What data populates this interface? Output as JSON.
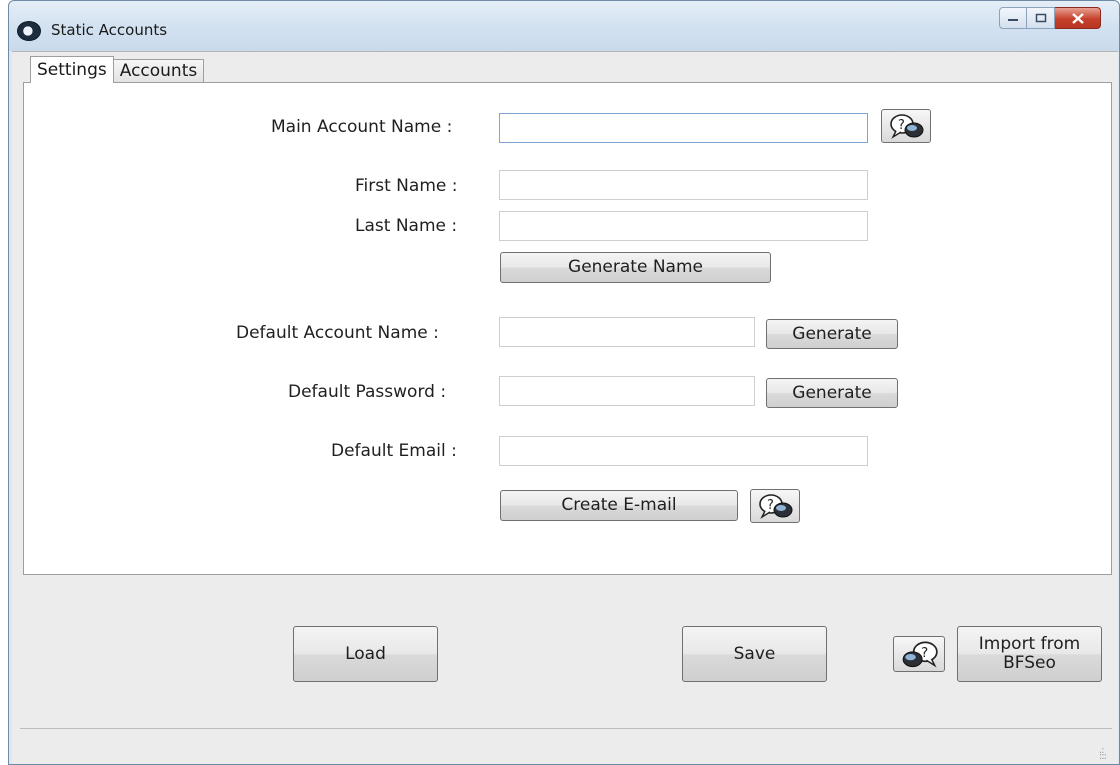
{
  "window": {
    "title": "Static Accounts"
  },
  "tabs": [
    {
      "label": "Settings"
    },
    {
      "label": "Accounts"
    }
  ],
  "form": {
    "main_account_name": {
      "label": "Main Account Name :",
      "value": ""
    },
    "first_name": {
      "label": "First Name :",
      "value": ""
    },
    "last_name": {
      "label": "Last Name :",
      "value": ""
    },
    "generate_name_button": "Generate Name",
    "default_account_name": {
      "label": "Default Account Name :",
      "value": "",
      "generate_label": "Generate"
    },
    "default_password": {
      "label": "Default Password :",
      "value": "",
      "generate_label": "Generate"
    },
    "default_email": {
      "label": "Default Email :",
      "value": ""
    },
    "create_email_button": "Create E-mail"
  },
  "footer": {
    "load_label": "Load",
    "save_label": "Save",
    "import_label_line1": "Import from",
    "import_label_line2": "BFSeo"
  },
  "icons": {
    "app": "eye-icon",
    "help": "help-bubble-icon"
  }
}
